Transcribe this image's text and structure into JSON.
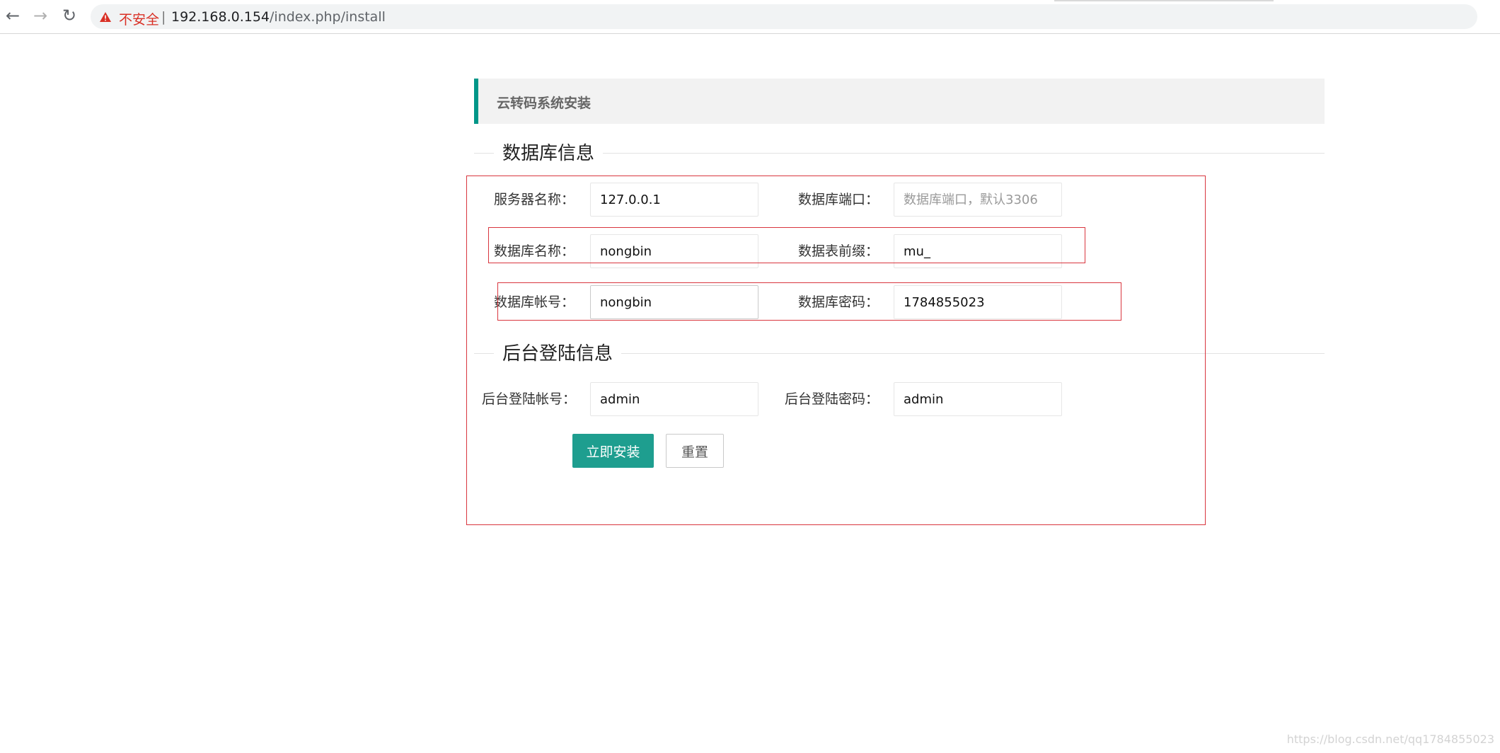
{
  "browser": {
    "security_label": "不安全",
    "separator": "|",
    "url_host": "192.168.0.154",
    "url_path": "/index.php/install",
    "icons": [
      "back-arrow-icon",
      "forward-arrow-icon",
      "reload-icon",
      "warning-icon"
    ]
  },
  "page": {
    "title": "云转码系统安装"
  },
  "db_section": {
    "legend": "数据库信息",
    "fields": {
      "server_label": "服务器名称：",
      "server_value": "127.0.0.1",
      "port_label": "数据库端口：",
      "port_placeholder": "数据库端口，默认3306",
      "dbname_label": "数据库名称：",
      "dbname_value": "nongbin",
      "prefix_label": "数据表前缀：",
      "prefix_value": "mu_",
      "user_label": "数据库帐号：",
      "user_value": "nongbin",
      "password_label": "数据库密码：",
      "password_value": "1784855023"
    }
  },
  "admin_section": {
    "legend": "后台登陆信息",
    "fields": {
      "admin_user_label": "后台登陆帐号：",
      "admin_user_value": "admin",
      "admin_pass_label": "后台登陆密码：",
      "admin_pass_value": "admin"
    }
  },
  "actions": {
    "install_label": "立即安装",
    "reset_label": "重置"
  },
  "colors": {
    "accent": "#009688",
    "install_button": "#1e9e8f",
    "annotation": "#d9363e",
    "insecure": "#d93025"
  },
  "watermark": "https://blog.csdn.net/qq1784855023"
}
